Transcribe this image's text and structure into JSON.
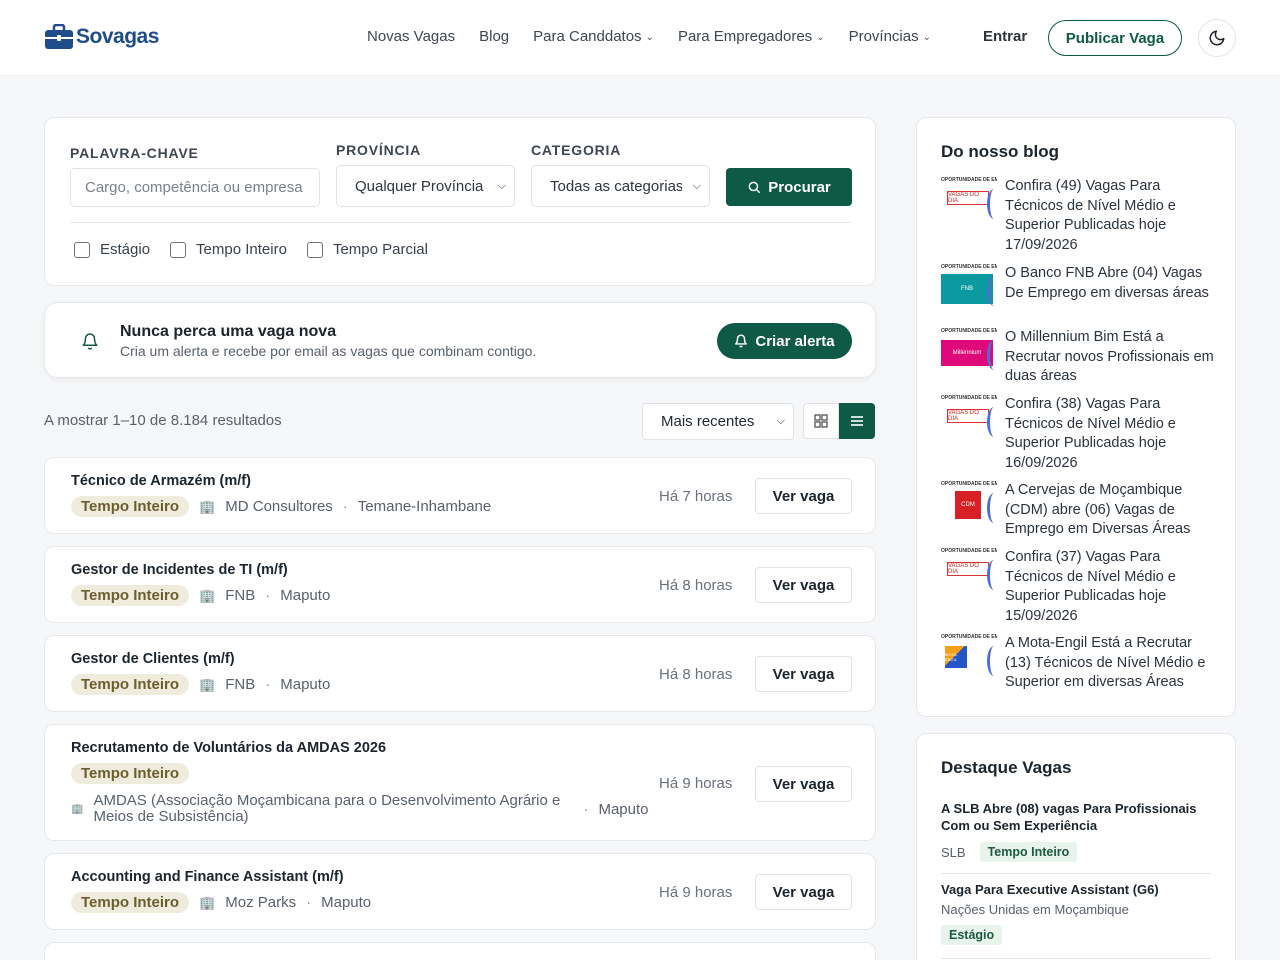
{
  "header": {
    "logo_text": "Sovagas",
    "nav": [
      {
        "label": "Novas Vagas",
        "dropdown": false
      },
      {
        "label": "Blog",
        "dropdown": false
      },
      {
        "label": "Para Canddatos",
        "dropdown": true
      },
      {
        "label": "Para Empregadores",
        "dropdown": true
      },
      {
        "label": "Províncias",
        "dropdown": true
      }
    ],
    "login": "Entrar",
    "publish": "Publicar Vaga",
    "theme_icon": "moon-icon"
  },
  "search": {
    "keyword_label": "PALAVRA-CHAVE",
    "keyword_placeholder": "Cargo, competência ou empresa",
    "province_label": "PROVÍNCIA",
    "province_value": "Qualquer Província",
    "category_label": "CATEGORIA",
    "category_value": "Todas as categorias",
    "button": "Procurar",
    "checks": [
      "Estágio",
      "Tempo Inteiro",
      "Tempo Parcial"
    ]
  },
  "alert": {
    "title": "Nunca perca uma vaga nova",
    "subtitle": "Cria um alerta e recebe por email as vagas que combinam contigo.",
    "button": "Criar alerta"
  },
  "results": {
    "count": "A mostrar 1–10 de 8.184 resultados",
    "sort": "Mais recentes"
  },
  "jobs": [
    {
      "title": "Técnico de Armazém (m/f)",
      "type": "Tempo Inteiro",
      "company": "MD Consultores",
      "location": "Temane-Inhambane",
      "time": "Há 7 horas",
      "action": "Ver vaga"
    },
    {
      "title": "Gestor de Incidentes de TI (m/f)",
      "type": "Tempo Inteiro",
      "company": "FNB",
      "location": "Maputo",
      "time": "Há 8 horas",
      "action": "Ver vaga"
    },
    {
      "title": "Gestor de Clientes (m/f)",
      "type": "Tempo Inteiro",
      "company": "FNB",
      "location": "Maputo",
      "time": "Há 8 horas",
      "action": "Ver vaga"
    },
    {
      "title": "Recrutamento de Voluntários da AMDAS 2026",
      "type": "Tempo Inteiro",
      "company": "AMDAS (Associação Moçambicana para o Desenvolvimento Agrário e Meios de Subsistência)",
      "location": "Maputo",
      "time": "Há 9 horas",
      "action": "Ver vaga"
    },
    {
      "title": "Accounting and Finance Assistant (m/f)",
      "type": "Tempo Inteiro",
      "company": "Moz Parks",
      "location": "Maputo",
      "time": "Há 9 horas",
      "action": "Ver vaga"
    }
  ],
  "blog": {
    "title": "Do nosso blog",
    "items": [
      {
        "text": "Confira (49) Vagas Para Técnicos de Nível Médio e Superior Publicadas hoje 17/09/2026",
        "thumb_header": "OPORTUNIDADE DE EMPREGO",
        "thumb_label": "VAGAS DO DIA",
        "thumb_color": "#ffffff"
      },
      {
        "text": "O Banco FNB Abre (04) Vagas De Emprego em diversas áreas",
        "thumb_header": "OPORTUNIDADE DE EMPREGO",
        "thumb_label": "FNB",
        "thumb_color": "#0b9aa0"
      },
      {
        "text": "O Millennium Bim Está a Recrutar novos Profissionais em duas áreas",
        "thumb_header": "OPORTUNIDADE DE EMPREGO",
        "thumb_label": "Millennium",
        "thumb_color": "#e0097a"
      },
      {
        "text": "Confira (38) Vagas Para Técnicos de Nível Médio e Superior Publicadas hoje 16/09/2026",
        "thumb_header": "OPORTUNIDADE DE EMPREGO",
        "thumb_label": "VAGAS DO DIA",
        "thumb_color": "#ffffff"
      },
      {
        "text": "A Cervejas de Moçambique (CDM) abre (06) Vagas de Emprego em Diversas Áreas",
        "thumb_header": "OPORTUNIDADE DE EMPREGO",
        "thumb_label": "CDM",
        "thumb_color": "#d71f26"
      },
      {
        "text": "Confira (37) Vagas Para Técnicos de Nível Médio e Superior Publicadas hoje 15/09/2026",
        "thumb_header": "OPORTUNIDADE DE EMPREGO",
        "thumb_label": "VAGAS DO DIA",
        "thumb_color": "#ffffff"
      },
      {
        "text": "A Mota-Engil Está a Recrutar (13) Técnicos de Nível Médio e Superior em diversas Áreas",
        "thumb_header": "OPORTUNIDADE DE EMPREGO",
        "thumb_label": "MOTA-ENGIL",
        "thumb_color": "#f4a11a"
      }
    ]
  },
  "featured": {
    "title": "Destaque Vagas",
    "items": [
      {
        "title": "A SLB Abre (08) vagas Para Profissionais Com ou Sem Experiência",
        "company": "SLB",
        "type": "Tempo Inteiro"
      },
      {
        "title": "Vaga Para Executive Assistant (G6)",
        "company": "Nações Unidas em Moçambique",
        "type": "Estágio"
      }
    ]
  },
  "colors": {
    "primary": "#0e5a47",
    "badge_bg": "#f0ecdd",
    "background": "#f6f7f8"
  }
}
